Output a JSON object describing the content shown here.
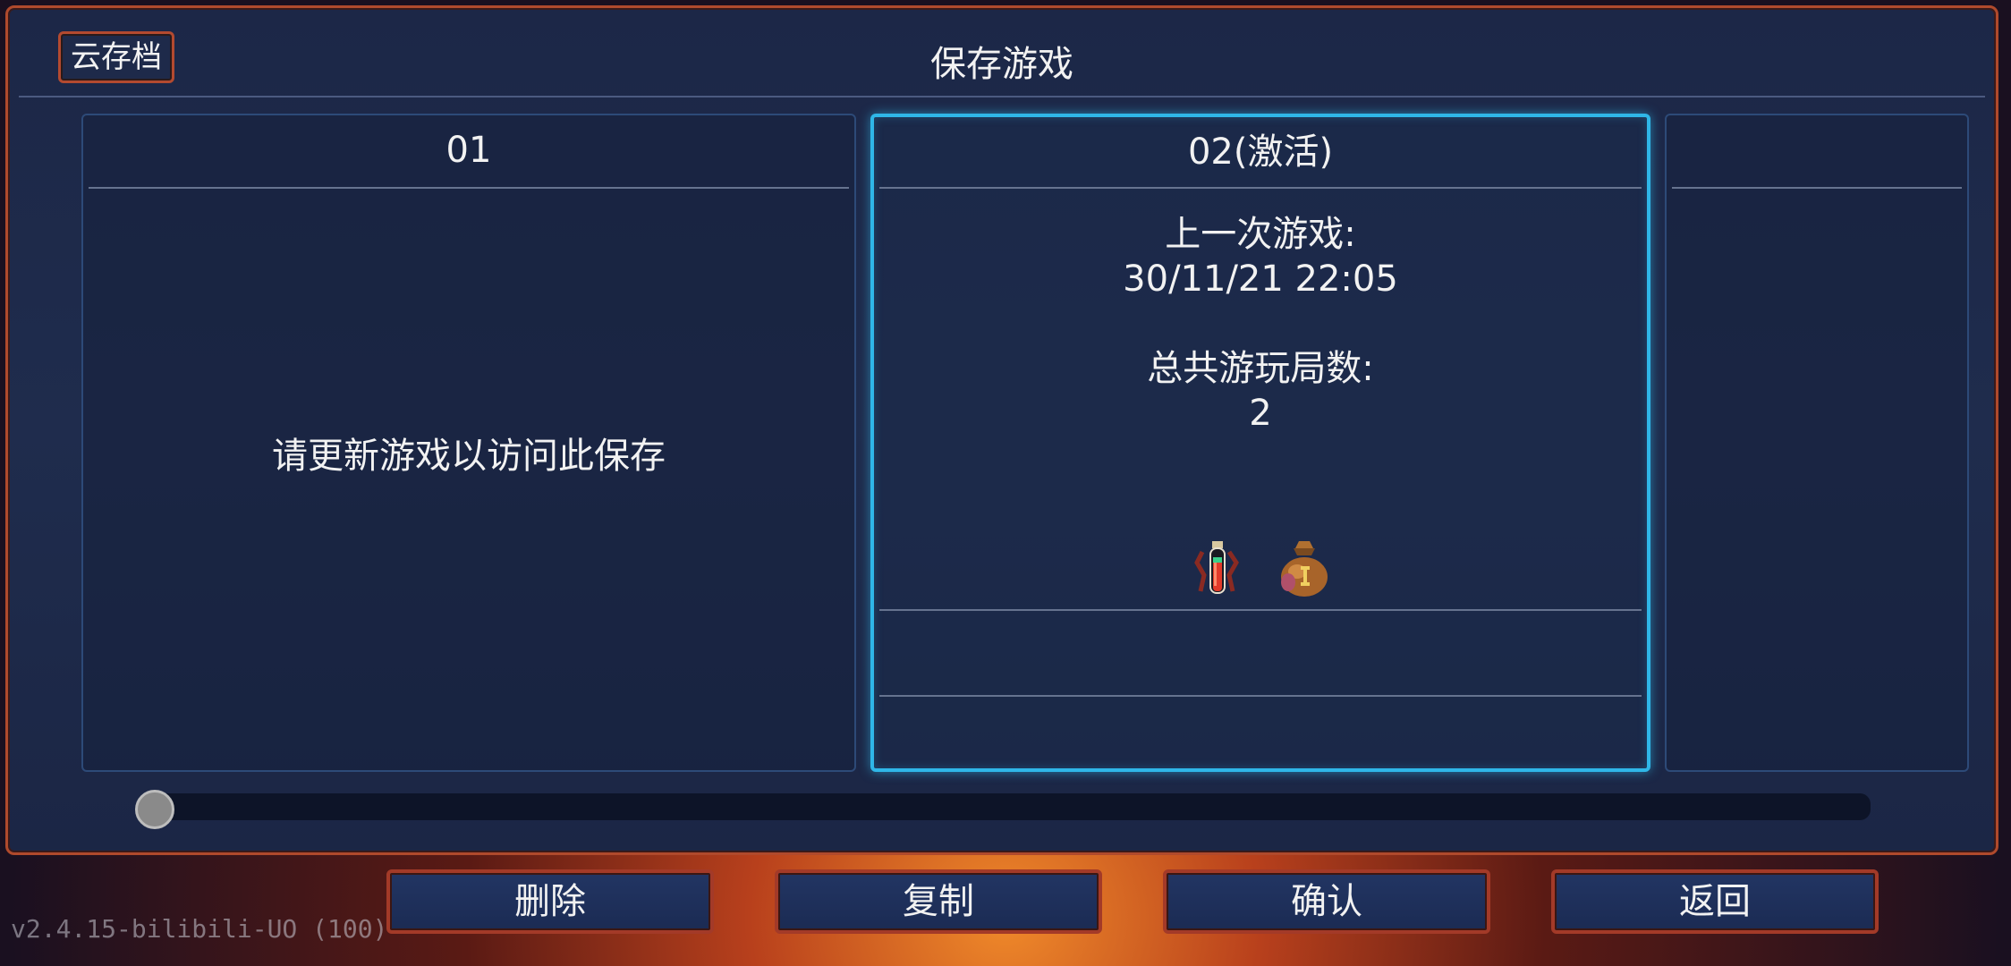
{
  "header": {
    "cloud_save": "云存档",
    "title": "保存游戏"
  },
  "slots": [
    {
      "label": "01",
      "message": "请更新游戏以访问此保存"
    },
    {
      "label": "02(激活)",
      "last_played_label": "上一次游戏:",
      "last_played_value": "30/11/21  22:05",
      "total_runs_label": "总共游玩局数:",
      "total_runs_value": "2",
      "items": [
        "potion-icon",
        "money-bag-icon"
      ]
    },
    {
      "label": ""
    }
  ],
  "scrollbar": {
    "position": 0
  },
  "buttons": {
    "delete": "删除",
    "copy": "复制",
    "confirm": "确认",
    "back": "返回"
  },
  "version": "v2.4.15-bilibili-UO (100)",
  "colors": {
    "active_border": "#2fb7e8",
    "button_border": "#a33a28",
    "panel_border": "#b04a2c"
  }
}
